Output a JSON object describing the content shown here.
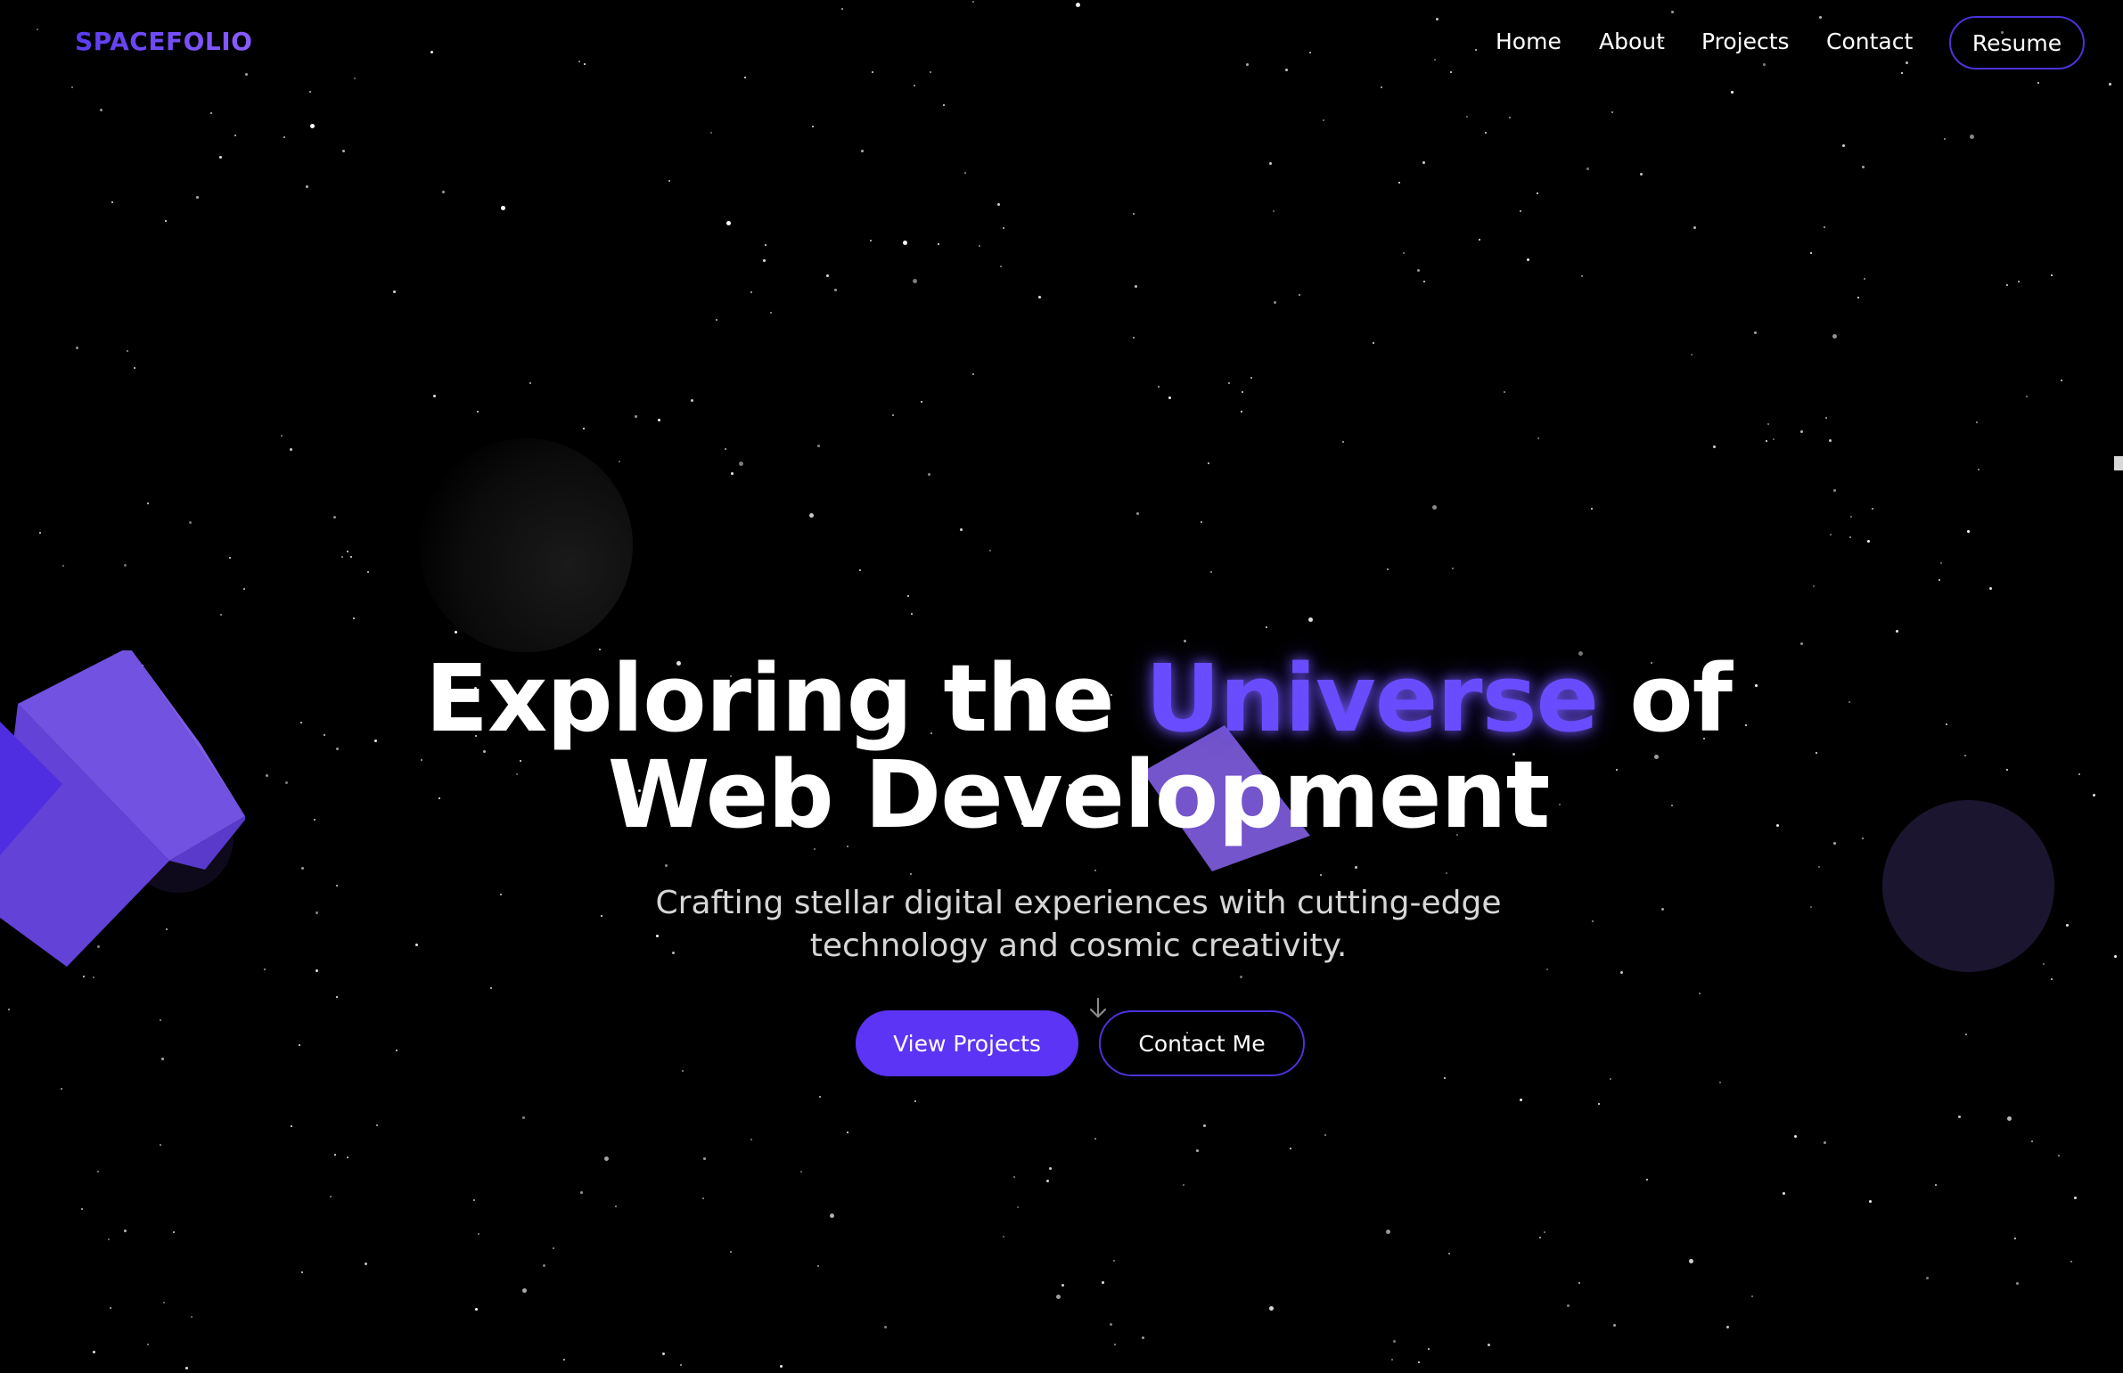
{
  "brand": {
    "logo": "SPACEFOLIO",
    "accent_color": "#6a4cff"
  },
  "nav": {
    "items": [
      {
        "label": "Home"
      },
      {
        "label": "About"
      },
      {
        "label": "Projects"
      },
      {
        "label": "Contact"
      }
    ],
    "resume_label": "Resume"
  },
  "hero": {
    "title_part1": "Exploring the ",
    "title_accent": "Universe",
    "title_part2": " of",
    "title_line2": "Web Development",
    "subtitle_line1": "Crafting stellar digital experiences with cutting-edge",
    "subtitle_line2": "technology and cosmic creativity.",
    "primary_button": "View Projects",
    "secondary_button": "Contact Me",
    "scroll_icon": "arrow-down-icon"
  },
  "colors": {
    "background": "#000000",
    "primary": "#5b34f5",
    "outline": "#4a34d8",
    "cube": "#6a48d8"
  }
}
